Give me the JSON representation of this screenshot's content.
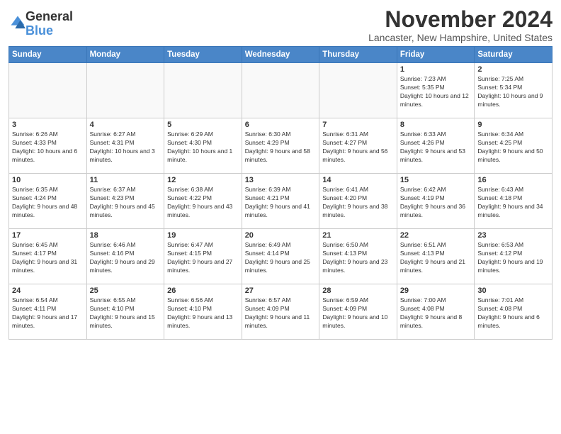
{
  "logo": {
    "general": "General",
    "blue": "Blue"
  },
  "header": {
    "month": "November 2024",
    "location": "Lancaster, New Hampshire, United States"
  },
  "weekdays": [
    "Sunday",
    "Monday",
    "Tuesday",
    "Wednesday",
    "Thursday",
    "Friday",
    "Saturday"
  ],
  "weeks": [
    [
      {
        "day": "",
        "info": ""
      },
      {
        "day": "",
        "info": ""
      },
      {
        "day": "",
        "info": ""
      },
      {
        "day": "",
        "info": ""
      },
      {
        "day": "",
        "info": ""
      },
      {
        "day": "1",
        "info": "Sunrise: 7:23 AM\nSunset: 5:35 PM\nDaylight: 10 hours and 12 minutes."
      },
      {
        "day": "2",
        "info": "Sunrise: 7:25 AM\nSunset: 5:34 PM\nDaylight: 10 hours and 9 minutes."
      }
    ],
    [
      {
        "day": "3",
        "info": "Sunrise: 6:26 AM\nSunset: 4:33 PM\nDaylight: 10 hours and 6 minutes."
      },
      {
        "day": "4",
        "info": "Sunrise: 6:27 AM\nSunset: 4:31 PM\nDaylight: 10 hours and 3 minutes."
      },
      {
        "day": "5",
        "info": "Sunrise: 6:29 AM\nSunset: 4:30 PM\nDaylight: 10 hours and 1 minute."
      },
      {
        "day": "6",
        "info": "Sunrise: 6:30 AM\nSunset: 4:29 PM\nDaylight: 9 hours and 58 minutes."
      },
      {
        "day": "7",
        "info": "Sunrise: 6:31 AM\nSunset: 4:27 PM\nDaylight: 9 hours and 56 minutes."
      },
      {
        "day": "8",
        "info": "Sunrise: 6:33 AM\nSunset: 4:26 PM\nDaylight: 9 hours and 53 minutes."
      },
      {
        "day": "9",
        "info": "Sunrise: 6:34 AM\nSunset: 4:25 PM\nDaylight: 9 hours and 50 minutes."
      }
    ],
    [
      {
        "day": "10",
        "info": "Sunrise: 6:35 AM\nSunset: 4:24 PM\nDaylight: 9 hours and 48 minutes."
      },
      {
        "day": "11",
        "info": "Sunrise: 6:37 AM\nSunset: 4:23 PM\nDaylight: 9 hours and 45 minutes."
      },
      {
        "day": "12",
        "info": "Sunrise: 6:38 AM\nSunset: 4:22 PM\nDaylight: 9 hours and 43 minutes."
      },
      {
        "day": "13",
        "info": "Sunrise: 6:39 AM\nSunset: 4:21 PM\nDaylight: 9 hours and 41 minutes."
      },
      {
        "day": "14",
        "info": "Sunrise: 6:41 AM\nSunset: 4:20 PM\nDaylight: 9 hours and 38 minutes."
      },
      {
        "day": "15",
        "info": "Sunrise: 6:42 AM\nSunset: 4:19 PM\nDaylight: 9 hours and 36 minutes."
      },
      {
        "day": "16",
        "info": "Sunrise: 6:43 AM\nSunset: 4:18 PM\nDaylight: 9 hours and 34 minutes."
      }
    ],
    [
      {
        "day": "17",
        "info": "Sunrise: 6:45 AM\nSunset: 4:17 PM\nDaylight: 9 hours and 31 minutes."
      },
      {
        "day": "18",
        "info": "Sunrise: 6:46 AM\nSunset: 4:16 PM\nDaylight: 9 hours and 29 minutes."
      },
      {
        "day": "19",
        "info": "Sunrise: 6:47 AM\nSunset: 4:15 PM\nDaylight: 9 hours and 27 minutes."
      },
      {
        "day": "20",
        "info": "Sunrise: 6:49 AM\nSunset: 4:14 PM\nDaylight: 9 hours and 25 minutes."
      },
      {
        "day": "21",
        "info": "Sunrise: 6:50 AM\nSunset: 4:13 PM\nDaylight: 9 hours and 23 minutes."
      },
      {
        "day": "22",
        "info": "Sunrise: 6:51 AM\nSunset: 4:13 PM\nDaylight: 9 hours and 21 minutes."
      },
      {
        "day": "23",
        "info": "Sunrise: 6:53 AM\nSunset: 4:12 PM\nDaylight: 9 hours and 19 minutes."
      }
    ],
    [
      {
        "day": "24",
        "info": "Sunrise: 6:54 AM\nSunset: 4:11 PM\nDaylight: 9 hours and 17 minutes."
      },
      {
        "day": "25",
        "info": "Sunrise: 6:55 AM\nSunset: 4:10 PM\nDaylight: 9 hours and 15 minutes."
      },
      {
        "day": "26",
        "info": "Sunrise: 6:56 AM\nSunset: 4:10 PM\nDaylight: 9 hours and 13 minutes."
      },
      {
        "day": "27",
        "info": "Sunrise: 6:57 AM\nSunset: 4:09 PM\nDaylight: 9 hours and 11 minutes."
      },
      {
        "day": "28",
        "info": "Sunrise: 6:59 AM\nSunset: 4:09 PM\nDaylight: 9 hours and 10 minutes."
      },
      {
        "day": "29",
        "info": "Sunrise: 7:00 AM\nSunset: 4:08 PM\nDaylight: 9 hours and 8 minutes."
      },
      {
        "day": "30",
        "info": "Sunrise: 7:01 AM\nSunset: 4:08 PM\nDaylight: 9 hours and 6 minutes."
      }
    ]
  ]
}
